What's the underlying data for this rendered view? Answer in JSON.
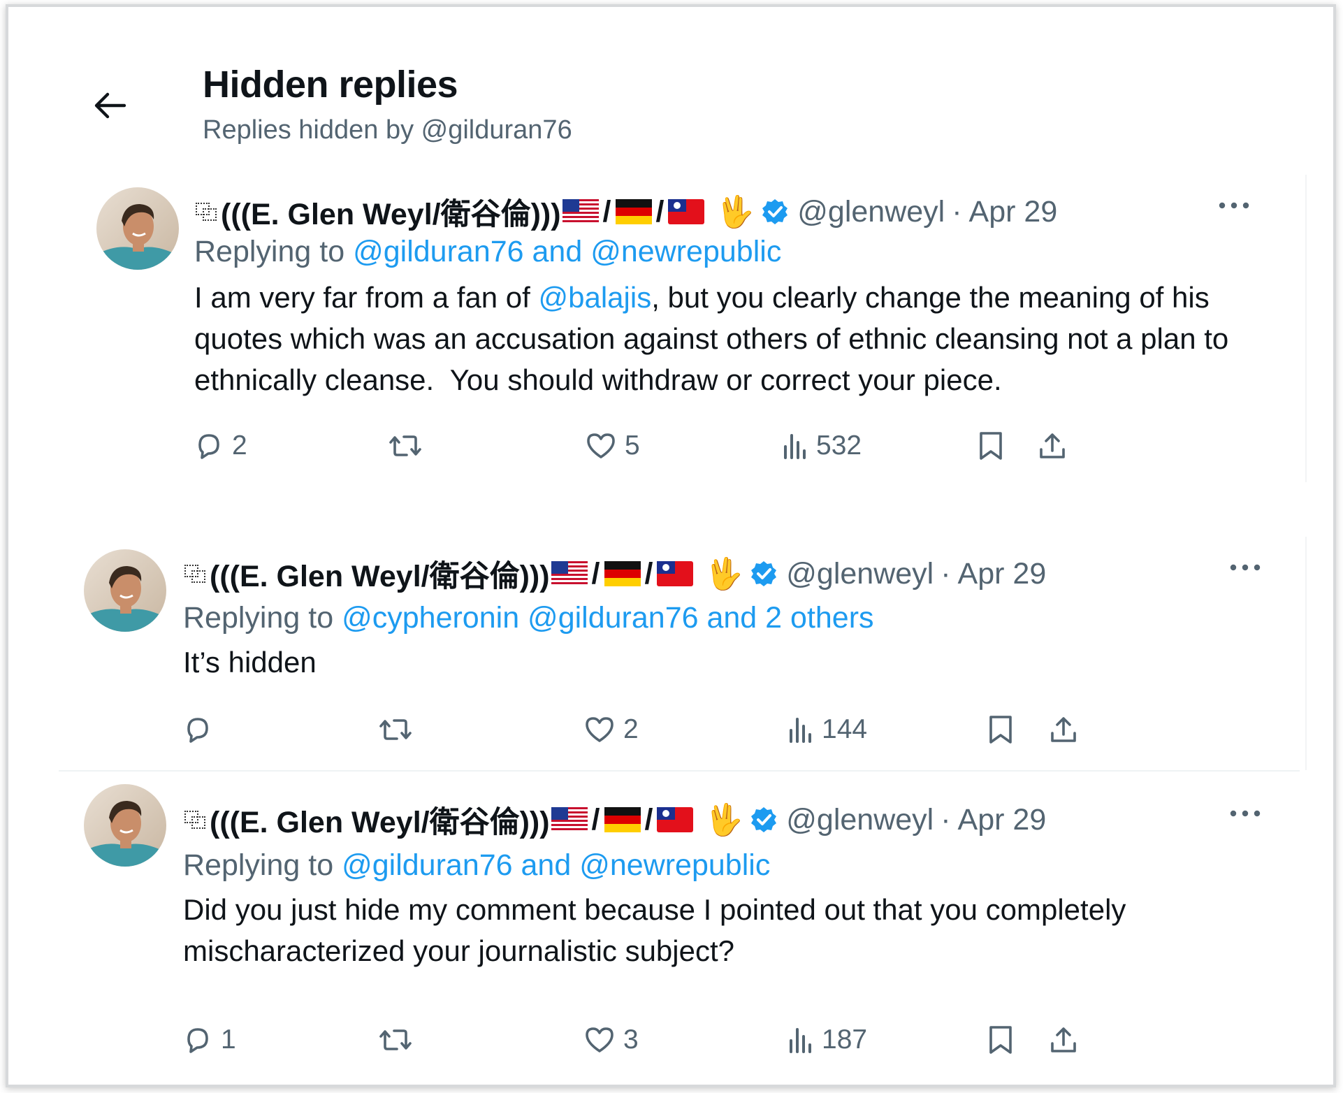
{
  "header": {
    "title": "Hidden replies",
    "subtitle": "Replies hidden by @gilduran76"
  },
  "colors": {
    "accent": "#1d9bf0",
    "muted_text": "#536471",
    "primary_text": "#0f1419"
  },
  "tweets": [
    {
      "name": "(((E. Glen Weyl/衛谷倫)))",
      "slash": "/",
      "hand": "🖖",
      "handle": "@glenweyl",
      "separator": "·",
      "date": "Apr 29",
      "replying_prefix": "Replying to",
      "replying_links": "@gilduran76 and @newrepublic",
      "body_before": "I am very far from a fan of ",
      "body_mention": "@balajis",
      "body_after": ", but you clearly change the meaning of his quotes which was an accusation against others of ethnic cleansing not a plan to ethnically cleanse.  You should withdraw or correct your piece.",
      "replies": "2",
      "retweets": "",
      "likes": "5",
      "views": "532"
    },
    {
      "name": "(((E. Glen Weyl/衛谷倫)))",
      "slash": "/",
      "hand": "🖖",
      "handle": "@glenweyl",
      "separator": "·",
      "date": "Apr 29",
      "replying_prefix": "Replying to",
      "replying_links": "@cypheronin @gilduran76 and 2 others",
      "body": "It’s hidden",
      "replies": "",
      "retweets": "",
      "likes": "2",
      "views": "144"
    },
    {
      "name": "(((E. Glen Weyl/衛谷倫)))",
      "slash": "/",
      "hand": "🖖",
      "handle": "@glenweyl",
      "separator": "·",
      "date": "Apr 29",
      "replying_prefix": "Replying to",
      "replying_links": "@gilduran76 and @newrepublic",
      "body": "Did you just hide my comment because I pointed out that you completely mischaracterized your journalistic subject?",
      "replies": "1",
      "retweets": "",
      "likes": "3",
      "views": "187"
    }
  ],
  "icons": {
    "back": "arrow-left-icon",
    "more": "more-horizontal-icon",
    "reply": "reply-icon",
    "retweet": "retweet-icon",
    "like": "heart-icon",
    "views": "views-icon",
    "bookmark": "bookmark-icon",
    "share": "share-icon",
    "verified": "verified-badge-icon",
    "flags": [
      "us-flag-icon",
      "germany-flag-icon",
      "taiwan-flag-icon"
    ]
  }
}
